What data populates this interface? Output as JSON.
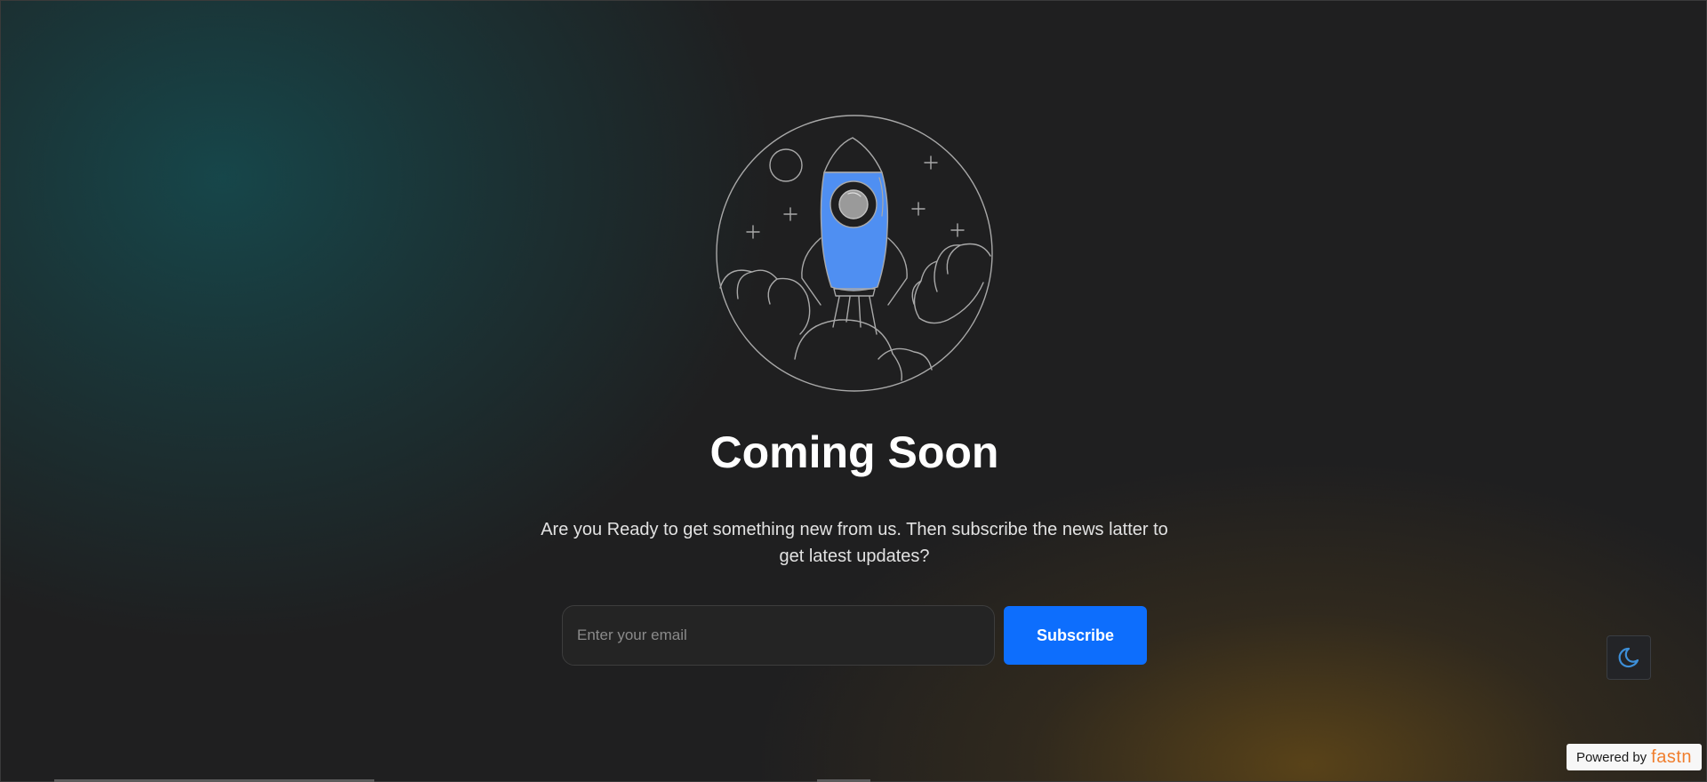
{
  "hero": {
    "illustration_icon": "rocket-launch-illustration",
    "title": "Coming Soon",
    "description": "Are you Ready to get something new from us. Then subscribe the news latter to get latest updates?"
  },
  "subscribe": {
    "email_placeholder": "Enter your email",
    "email_value": "",
    "button_label": "Subscribe"
  },
  "theme_toggle": {
    "icon": "moon-icon"
  },
  "badge": {
    "powered_label": "Powered by",
    "brand": "fastn"
  },
  "colors": {
    "accent": "#0d6efd",
    "rocket_body": "#4f8ff2",
    "brand": "#f07e2d",
    "background": "#1f1f20",
    "teal_glow": "#16484c",
    "gold_glow": "#6c4e16"
  }
}
